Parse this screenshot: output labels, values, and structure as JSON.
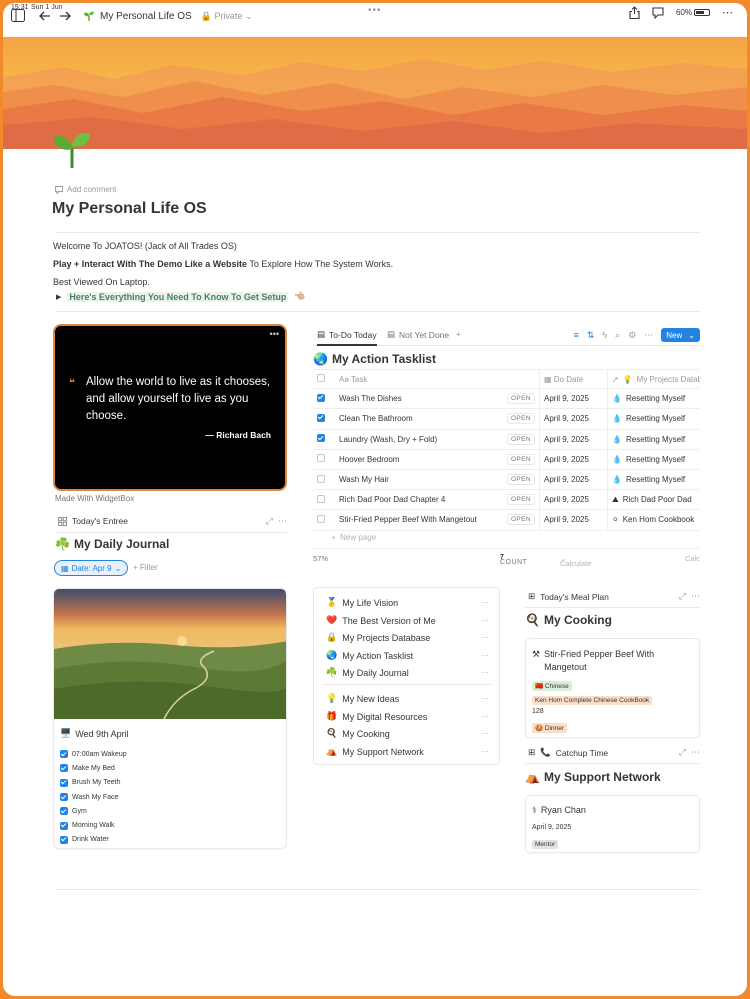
{
  "status_bar": {
    "time": "15:31",
    "date": "Sun 1 Jun",
    "battery": "60%"
  },
  "topbar": {
    "page_name": "My Personal Life OS",
    "privacy": "Private"
  },
  "page": {
    "add_comment": "Add comment",
    "title": "My Personal Life OS",
    "intro_line1": "Welcome To JOATOS! (Jack of All Trades OS)",
    "intro_line2_bold": "Play + Interact With The Demo Like a Website",
    "intro_line2_rest": " To Explore How The System Works.",
    "intro_line3": "Best Viewed On Laptop.",
    "toggle_label": "Here's Everything You Need To Know To Get Setup"
  },
  "quote_widget": {
    "text": "Allow the world to live as it chooses, and allow yourself to live as you choose.",
    "author": "— Richard Bach",
    "caption": "Made With WidgetBox"
  },
  "journal": {
    "view_name": "Today's Entree",
    "title": "My Daily Journal",
    "date_filter": "Date: Apr 9",
    "filter_label": "Filter",
    "entry_date": "Wed 9th April",
    "checklist": [
      {
        "label": "07:00am Wakeup",
        "checked": true
      },
      {
        "label": "Make My Bed",
        "checked": true
      },
      {
        "label": "Brush My Teeth",
        "checked": true
      },
      {
        "label": "Wash My Face",
        "checked": true
      },
      {
        "label": "Gym",
        "checked": true
      },
      {
        "label": "Morning Walk",
        "checked": true
      },
      {
        "label": "Drink Water",
        "checked": true
      }
    ]
  },
  "tasks": {
    "tabs": [
      "To-Do Today",
      "Not Yet Done"
    ],
    "new_button": "New",
    "title": "My Action Tasklist",
    "columns": {
      "task": "Task",
      "date": "Do Date",
      "project": "My Projects Datab"
    },
    "open_label": "OPEN",
    "rows": [
      {
        "task": "Wash The Dishes",
        "done": true,
        "date": "April 9, 2025",
        "project": "Resetting Myself",
        "icon": "💧"
      },
      {
        "task": "Clean The Bathroom",
        "done": true,
        "date": "April 9, 2025",
        "project": "Resetting Myself",
        "icon": "💧"
      },
      {
        "task": "Laundry (Wash, Dry + Fold)",
        "done": true,
        "date": "April 9, 2025",
        "project": "Resetting Myself",
        "icon": "💧"
      },
      {
        "task": "Hoover Bedroom",
        "done": false,
        "date": "April 9, 2025",
        "project": "Resetting Myself",
        "icon": "💧"
      },
      {
        "task": "Wash My Hair",
        "done": false,
        "date": "April 9, 2025",
        "project": "Resetting Myself",
        "icon": "💧"
      },
      {
        "task": "Rich Dad Poor Dad Chapter 4",
        "done": false,
        "date": "April 9, 2025",
        "project": "Rich Dad Poor Dad",
        "icon": "⛰"
      },
      {
        "task": "Stir-Fried Pepper Beef With Mangetout",
        "done": false,
        "date": "April 9, 2025",
        "project": "Ken Hom Cookbook",
        "icon": "⚪"
      }
    ],
    "new_page": "New page",
    "percent": "57%",
    "count_label": "COUNT",
    "count_value": "7",
    "calculate": "Calculate",
    "calc_clip": "Calc"
  },
  "menu": {
    "items": [
      {
        "icon": "🥇",
        "label": "My Life Vision"
      },
      {
        "icon": "❤️",
        "label": "The Best Version of Me"
      },
      {
        "icon": "🔒",
        "label": "My Projects Database"
      },
      {
        "icon": "🌏",
        "label": "My Action Tasklist"
      },
      {
        "icon": "☘️",
        "label": "My Daily Journal"
      },
      {
        "icon": "💡",
        "label": "My New Ideas"
      },
      {
        "icon": "🎁",
        "label": "My Digital Resources"
      },
      {
        "icon": "🍳",
        "label": "My Cooking"
      },
      {
        "icon": "⛺",
        "label": "My Support Network"
      }
    ]
  },
  "cooking": {
    "view_name": "Today's Meal Plan",
    "title": "My Cooking",
    "card_title": "Stir-Fried Pepper Beef With Mangetout",
    "cuisine": "Chinese",
    "book": "Ken Hom Complete Chinese CookBook",
    "page_no": "128",
    "meal": "Dinner"
  },
  "support": {
    "view_name": "Catchup Time",
    "title": "My Support Network",
    "card_title": "Ryan Chan",
    "date": "April 9, 2025",
    "role": "Mentor"
  }
}
